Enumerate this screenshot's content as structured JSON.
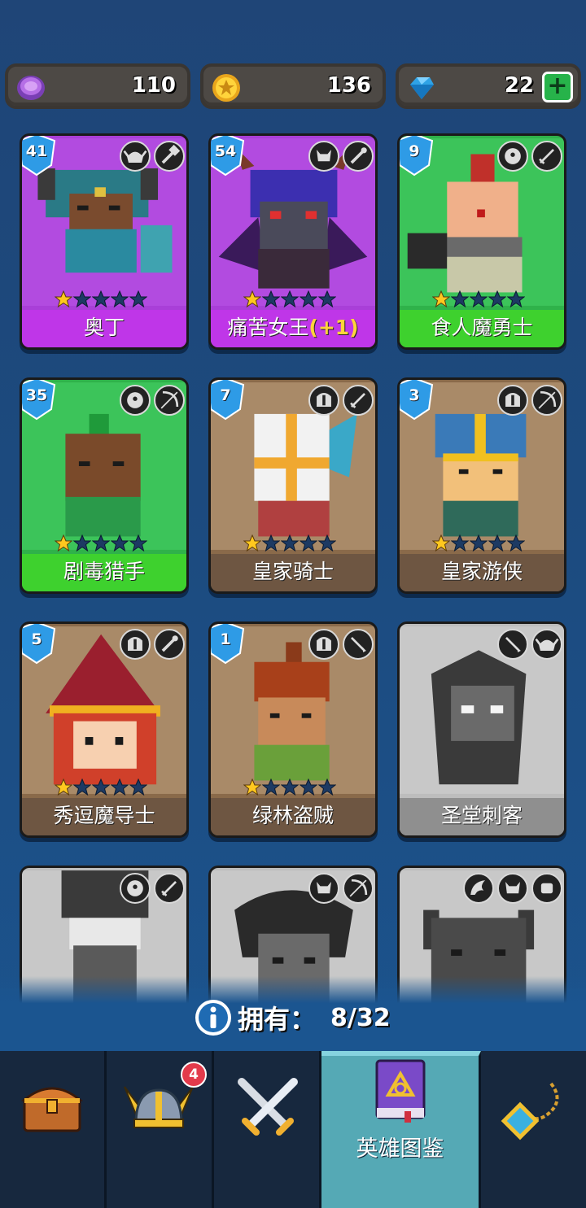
{
  "currencies": {
    "purple_coin": "110",
    "gold_coin": "136",
    "gems": "22",
    "add_label": "+"
  },
  "heroes": [
    {
      "name": "奥丁",
      "bonus": "",
      "level": "41",
      "stars": 1,
      "owned": true,
      "rarity": "epic"
    },
    {
      "name": "痛苦女王",
      "bonus": "(+1)",
      "level": "54",
      "stars": 1,
      "owned": true,
      "rarity": "epic"
    },
    {
      "name": "食人魔勇士",
      "bonus": "",
      "level": "9",
      "stars": 1,
      "owned": true,
      "rarity": "rare"
    },
    {
      "name": "剧毒猎手",
      "bonus": "",
      "level": "35",
      "stars": 1,
      "owned": true,
      "rarity": "rare"
    },
    {
      "name": "皇家骑士",
      "bonus": "",
      "level": "7",
      "stars": 1,
      "owned": true,
      "rarity": "common"
    },
    {
      "name": "皇家游侠",
      "bonus": "",
      "level": "3",
      "stars": 1,
      "owned": true,
      "rarity": "common"
    },
    {
      "name": "秀逗魔导士",
      "bonus": "",
      "level": "5",
      "stars": 1,
      "owned": true,
      "rarity": "common"
    },
    {
      "name": "绿林盗贼",
      "bonus": "",
      "level": "1",
      "stars": 1,
      "owned": true,
      "rarity": "common"
    },
    {
      "name": "圣堂刺客",
      "bonus": "",
      "level": "",
      "stars": 0,
      "owned": false,
      "rarity": "locked"
    }
  ],
  "owned_summary": {
    "label": "拥有：",
    "count": "8/32"
  },
  "nav": {
    "notification_count": "4",
    "active_tab_label": "英雄图鉴"
  }
}
